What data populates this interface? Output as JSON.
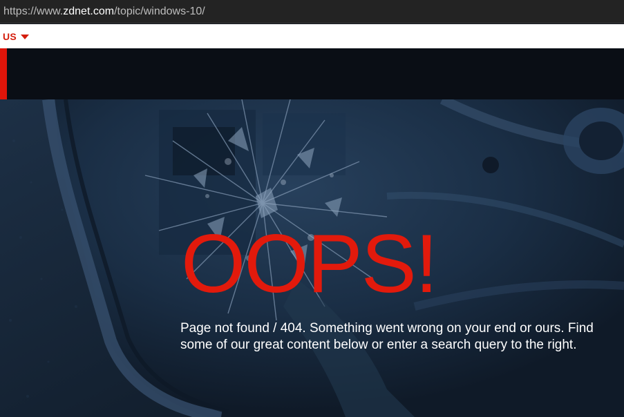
{
  "browser": {
    "url_scheme": "https://www.",
    "url_host": "zdnet.com",
    "url_path": "/topic/windows-10/"
  },
  "region": {
    "label": "US",
    "caret_icon": "caret-down-icon"
  },
  "header": {
    "accent_color": "#e0150a",
    "background_color": "#0a0e15"
  },
  "hero": {
    "headline": "OOPS!",
    "headline_color": "#e21a0c",
    "message": "Page not found / 404. Something went wrong on your end or ours. Find some of our great content below or enter a search query to the right.",
    "background_image": "shattered-phone-screen"
  }
}
